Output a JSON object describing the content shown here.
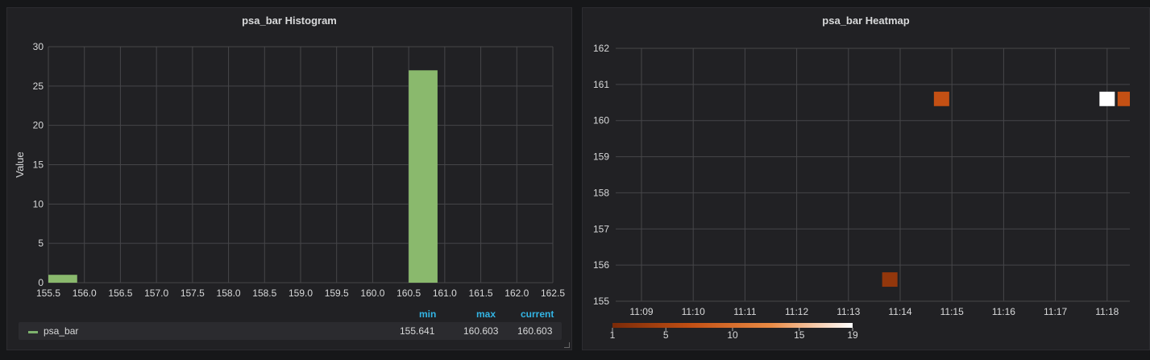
{
  "colors": {
    "bar": "#8ab96d",
    "grid": "#464649",
    "axis_text": "#d8d9da",
    "legend_header": "#33b5e5",
    "heat_low": "#7a2a08",
    "heat_high": "#ffffff"
  },
  "chart_data": [
    {
      "type": "bar",
      "title": "psa_bar Histogram",
      "xlabel": "",
      "ylabel": "Value",
      "xlim": [
        155.5,
        162.5
      ],
      "ylim": [
        0,
        30
      ],
      "x_ticks": [
        "155.5",
        "156.0",
        "156.5",
        "157.0",
        "157.5",
        "158.0",
        "158.5",
        "159.0",
        "159.5",
        "160.0",
        "160.5",
        "161.0",
        "161.5",
        "162.0",
        "162.5"
      ],
      "y_ticks": [
        "0",
        "5",
        "10",
        "15",
        "20",
        "25",
        "30"
      ],
      "bins": [
        {
          "start": 155.5,
          "end": 155.9,
          "value": 1
        },
        {
          "start": 160.5,
          "end": 160.9,
          "value": 27
        }
      ],
      "legend": {
        "headers": {
          "min": "min",
          "max": "max",
          "current": "current"
        },
        "series": [
          {
            "name": "psa_bar",
            "min": "155.641",
            "max": "160.603",
            "current": "160.603"
          }
        ]
      }
    },
    {
      "type": "heatmap",
      "title": "psa_bar Heatmap",
      "ylim": [
        155,
        162
      ],
      "y_ticks": [
        "155",
        "156",
        "157",
        "158",
        "159",
        "160",
        "161",
        "162"
      ],
      "x_ticks": [
        "11:09",
        "11:10",
        "11:11",
        "11:12",
        "11:13",
        "11:14",
        "11:15",
        "11:16",
        "11:17",
        "11:18"
      ],
      "cells": [
        {
          "time": "11:14",
          "offset_min": -0.2,
          "y_low": 155.4,
          "y_high": 155.8,
          "count": 3
        },
        {
          "time": "11:15",
          "offset_min": -0.2,
          "y_low": 160.4,
          "y_high": 160.8,
          "count": 7
        },
        {
          "time": "11:18",
          "offset_min": -0.0,
          "y_low": 160.4,
          "y_high": 160.8,
          "count": 19
        },
        {
          "time": "11:18",
          "offset_min": 0.35,
          "y_low": 160.4,
          "y_high": 160.8,
          "count": 7
        }
      ],
      "color_scale": {
        "min": 1,
        "max": 19,
        "ticks": [
          "1",
          "5",
          "10",
          "15",
          "19"
        ]
      }
    }
  ]
}
